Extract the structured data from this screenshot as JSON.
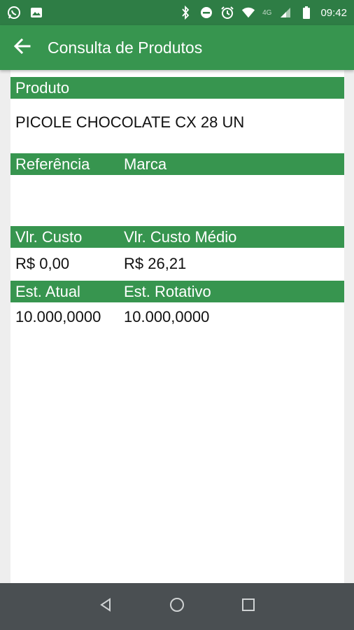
{
  "status_bar": {
    "time": "09:42",
    "network": "4G",
    "left_icons": [
      "whatsapp-icon",
      "image-icon"
    ],
    "right_icons": [
      "bluetooth-icon",
      "do-not-disturb-icon",
      "alarm-icon",
      "wifi-icon",
      "signal-icon",
      "battery-icon"
    ]
  },
  "app_bar": {
    "title": "Consulta de Produtos"
  },
  "produto": {
    "label": "Produto",
    "value": "PICOLE CHOCOLATE CX 28 UN"
  },
  "referencia": {
    "label": "Referência",
    "value": ""
  },
  "marca": {
    "label": "Marca",
    "value": ""
  },
  "vlr_custo": {
    "label": "Vlr. Custo",
    "value": "R$ 0,00"
  },
  "vlr_custo_medio": {
    "label": "Vlr. Custo Médio",
    "value": "R$ 26,21"
  },
  "est_atual": {
    "label": "Est. Atual",
    "value": "10.000,0000"
  },
  "est_rotativo": {
    "label": "Est. Rotativo",
    "value": "10.000,0000"
  },
  "colors": {
    "status_bar": "#2e7d45",
    "app_bar": "#37954f",
    "header_bar": "#37954f",
    "nav_bar": "#4a4f52",
    "background": "#eeeeee"
  }
}
